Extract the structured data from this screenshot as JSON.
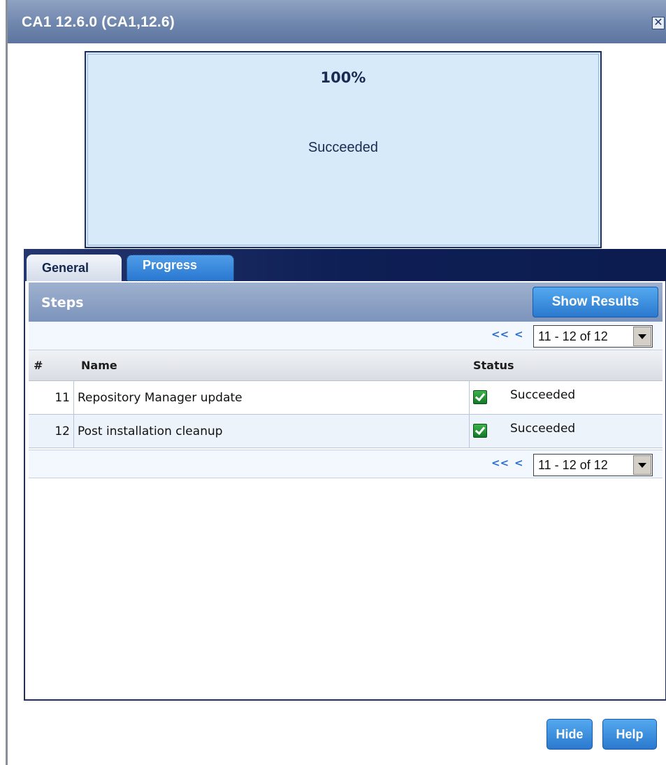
{
  "window": {
    "title": "CA1 12.6.0 (CA1,12.6)",
    "close_glyph": "✕",
    "close_icon": "close-icon"
  },
  "progress": {
    "percent_text": "100%",
    "percent_value": 100,
    "status_text": "Succeeded"
  },
  "tabs": [
    {
      "label": "General",
      "active": false
    },
    {
      "label": "Progress",
      "active": true
    }
  ],
  "steps_panel": {
    "title": "Steps",
    "show_results_label": "Show Results",
    "pager": {
      "first_glyph": "<<",
      "prev_glyph": "<",
      "range_text": "11 - 12 of 12"
    },
    "columns": {
      "num": "#",
      "name": "Name",
      "status": "Status"
    },
    "rows": [
      {
        "num": "11",
        "name": "Repository Manager update",
        "status": "Succeeded",
        "status_icon": "check-icon"
      },
      {
        "num": "12",
        "name": "Post installation cleanup",
        "status": "Succeeded",
        "status_icon": "check-icon"
      }
    ]
  },
  "footer": {
    "hide_label": "Hide",
    "help_label": "Help"
  },
  "colors": {
    "titlebar": "#6f86ad",
    "tabbar": "#0e1f55",
    "accent_button": "#2b79cf",
    "progress_bg": "#d7eaf9"
  }
}
